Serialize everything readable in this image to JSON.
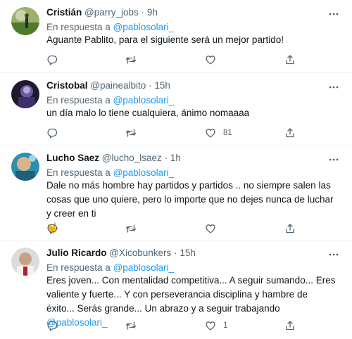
{
  "tweets": [
    {
      "name": "Cristián",
      "handle": "@parry_jobs",
      "separator": "·",
      "time": "9h",
      "reply_prefix": "En respuesta a",
      "reply_mention": "@pablosolari_",
      "text": "Aguante Pablito, para el siguiente será un mejor partido!",
      "likes": ""
    },
    {
      "name": "Cristobal",
      "handle": "@painealbito",
      "separator": "·",
      "time": "15h",
      "reply_prefix": "En respuesta a",
      "reply_mention": "@pablosolari_",
      "text": "un día malo lo tiene cualquiera, ánimo nomaaaa",
      "likes": "81"
    },
    {
      "name": "Lucho Saez",
      "handle": "@lucho_lsaez",
      "separator": "·",
      "time": "1h",
      "reply_prefix": "En respuesta a",
      "reply_mention": "@pablosolari_",
      "text": "Dale no más hombre hay partidos y partidos .. no siempre salen las cosas que uno quiere, pero lo importe que no dejes nunca de luchar y creer en ti",
      "emoji": "🤟",
      "likes": ""
    },
    {
      "name": "Julio Ricardo",
      "handle": "@Xicobunkers",
      "separator": "·",
      "time": "15h",
      "reply_prefix": "En respuesta a",
      "reply_mention": "@pablosolari_",
      "text_before": "Eres joven... Con mentalidad competitiva... A seguir sumando... Eres valiente y fuerte... Y con perseverancia disciplina y hambre de éxito... Serás grande... Un abrazo y a seguir trabajando ",
      "text_mention": "@pablosolari_",
      "likes": "1"
    }
  ],
  "icons": {
    "more": "more-horizontal-icon",
    "reply": "reply-icon",
    "retweet": "retweet-icon",
    "like": "like-icon",
    "share": "share-icon"
  },
  "colors": {
    "text": "#0f1419",
    "secondary": "#536471",
    "accent": "#1d9bf0",
    "divider": "#eff3f4"
  }
}
